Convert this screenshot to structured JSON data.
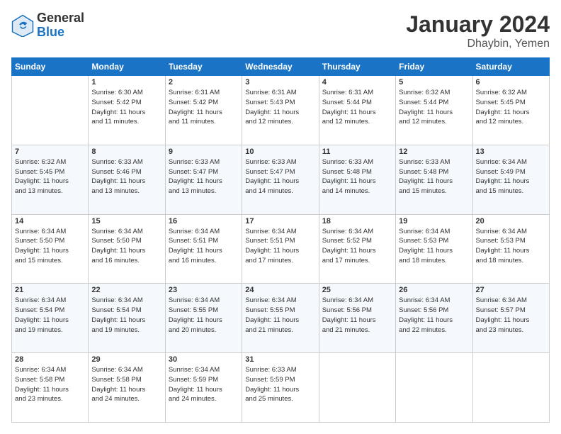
{
  "logo": {
    "general": "General",
    "blue": "Blue"
  },
  "title": "January 2024",
  "location": "Dhaybin, Yemen",
  "days": [
    "Sunday",
    "Monday",
    "Tuesday",
    "Wednesday",
    "Thursday",
    "Friday",
    "Saturday"
  ],
  "weeks": [
    [
      {
        "day": "",
        "info": ""
      },
      {
        "day": "1",
        "info": "Sunrise: 6:30 AM\nSunset: 5:42 PM\nDaylight: 11 hours\nand 11 minutes."
      },
      {
        "day": "2",
        "info": "Sunrise: 6:31 AM\nSunset: 5:42 PM\nDaylight: 11 hours\nand 11 minutes."
      },
      {
        "day": "3",
        "info": "Sunrise: 6:31 AM\nSunset: 5:43 PM\nDaylight: 11 hours\nand 12 minutes."
      },
      {
        "day": "4",
        "info": "Sunrise: 6:31 AM\nSunset: 5:44 PM\nDaylight: 11 hours\nand 12 minutes."
      },
      {
        "day": "5",
        "info": "Sunrise: 6:32 AM\nSunset: 5:44 PM\nDaylight: 11 hours\nand 12 minutes."
      },
      {
        "day": "6",
        "info": "Sunrise: 6:32 AM\nSunset: 5:45 PM\nDaylight: 11 hours\nand 12 minutes."
      }
    ],
    [
      {
        "day": "7",
        "info": "Sunrise: 6:32 AM\nSunset: 5:45 PM\nDaylight: 11 hours\nand 13 minutes."
      },
      {
        "day": "8",
        "info": "Sunrise: 6:33 AM\nSunset: 5:46 PM\nDaylight: 11 hours\nand 13 minutes."
      },
      {
        "day": "9",
        "info": "Sunrise: 6:33 AM\nSunset: 5:47 PM\nDaylight: 11 hours\nand 13 minutes."
      },
      {
        "day": "10",
        "info": "Sunrise: 6:33 AM\nSunset: 5:47 PM\nDaylight: 11 hours\nand 14 minutes."
      },
      {
        "day": "11",
        "info": "Sunrise: 6:33 AM\nSunset: 5:48 PM\nDaylight: 11 hours\nand 14 minutes."
      },
      {
        "day": "12",
        "info": "Sunrise: 6:33 AM\nSunset: 5:48 PM\nDaylight: 11 hours\nand 15 minutes."
      },
      {
        "day": "13",
        "info": "Sunrise: 6:34 AM\nSunset: 5:49 PM\nDaylight: 11 hours\nand 15 minutes."
      }
    ],
    [
      {
        "day": "14",
        "info": "Sunrise: 6:34 AM\nSunset: 5:50 PM\nDaylight: 11 hours\nand 15 minutes."
      },
      {
        "day": "15",
        "info": "Sunrise: 6:34 AM\nSunset: 5:50 PM\nDaylight: 11 hours\nand 16 minutes."
      },
      {
        "day": "16",
        "info": "Sunrise: 6:34 AM\nSunset: 5:51 PM\nDaylight: 11 hours\nand 16 minutes."
      },
      {
        "day": "17",
        "info": "Sunrise: 6:34 AM\nSunset: 5:51 PM\nDaylight: 11 hours\nand 17 minutes."
      },
      {
        "day": "18",
        "info": "Sunrise: 6:34 AM\nSunset: 5:52 PM\nDaylight: 11 hours\nand 17 minutes."
      },
      {
        "day": "19",
        "info": "Sunrise: 6:34 AM\nSunset: 5:53 PM\nDaylight: 11 hours\nand 18 minutes."
      },
      {
        "day": "20",
        "info": "Sunrise: 6:34 AM\nSunset: 5:53 PM\nDaylight: 11 hours\nand 18 minutes."
      }
    ],
    [
      {
        "day": "21",
        "info": "Sunrise: 6:34 AM\nSunset: 5:54 PM\nDaylight: 11 hours\nand 19 minutes."
      },
      {
        "day": "22",
        "info": "Sunrise: 6:34 AM\nSunset: 5:54 PM\nDaylight: 11 hours\nand 19 minutes."
      },
      {
        "day": "23",
        "info": "Sunrise: 6:34 AM\nSunset: 5:55 PM\nDaylight: 11 hours\nand 20 minutes."
      },
      {
        "day": "24",
        "info": "Sunrise: 6:34 AM\nSunset: 5:55 PM\nDaylight: 11 hours\nand 21 minutes."
      },
      {
        "day": "25",
        "info": "Sunrise: 6:34 AM\nSunset: 5:56 PM\nDaylight: 11 hours\nand 21 minutes."
      },
      {
        "day": "26",
        "info": "Sunrise: 6:34 AM\nSunset: 5:56 PM\nDaylight: 11 hours\nand 22 minutes."
      },
      {
        "day": "27",
        "info": "Sunrise: 6:34 AM\nSunset: 5:57 PM\nDaylight: 11 hours\nand 23 minutes."
      }
    ],
    [
      {
        "day": "28",
        "info": "Sunrise: 6:34 AM\nSunset: 5:58 PM\nDaylight: 11 hours\nand 23 minutes."
      },
      {
        "day": "29",
        "info": "Sunrise: 6:34 AM\nSunset: 5:58 PM\nDaylight: 11 hours\nand 24 minutes."
      },
      {
        "day": "30",
        "info": "Sunrise: 6:34 AM\nSunset: 5:59 PM\nDaylight: 11 hours\nand 24 minutes."
      },
      {
        "day": "31",
        "info": "Sunrise: 6:33 AM\nSunset: 5:59 PM\nDaylight: 11 hours\nand 25 minutes."
      },
      {
        "day": "",
        "info": ""
      },
      {
        "day": "",
        "info": ""
      },
      {
        "day": "",
        "info": ""
      }
    ]
  ]
}
